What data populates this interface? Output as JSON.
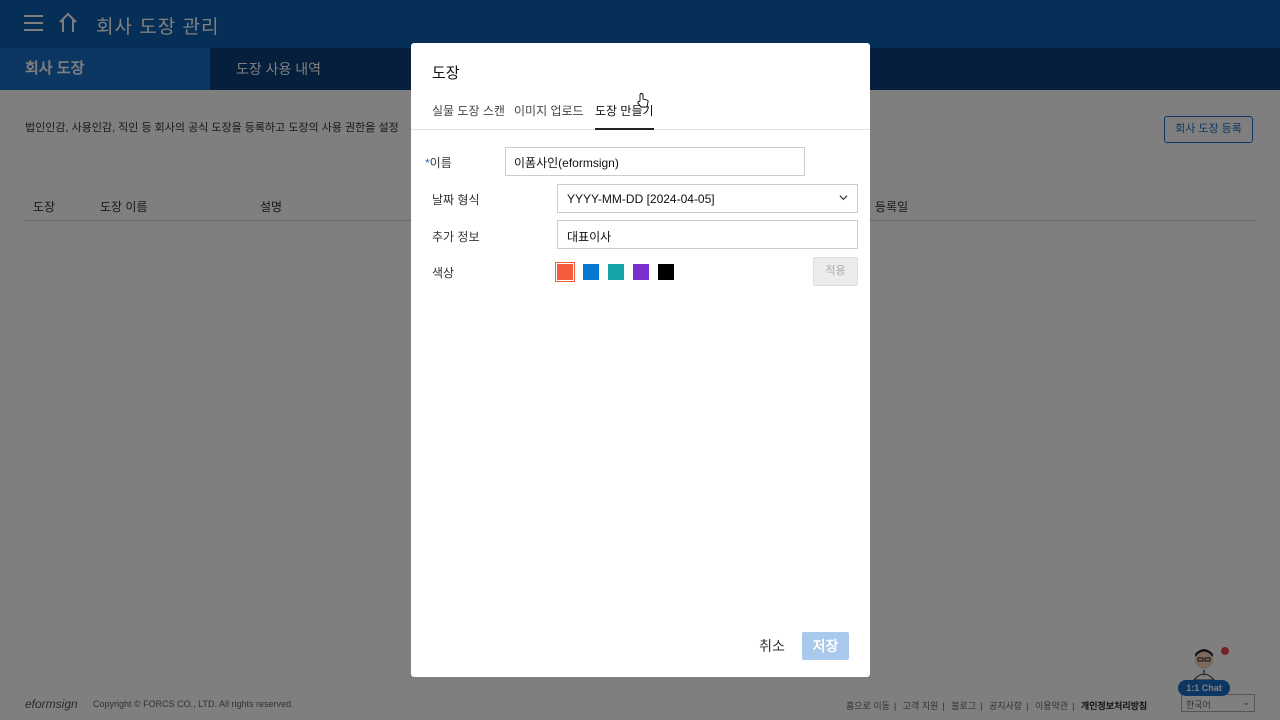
{
  "header": {
    "app_title": "회사 도장 관리"
  },
  "tabs": [
    {
      "label": "회사 도장"
    },
    {
      "label": "도장 사용 내역"
    }
  ],
  "description": "법인인감, 사용인감, 직인 등 회사의 공식 도장을 등록하고 도장의 사용 권한을 설정",
  "register_button": "회사 도장 등록",
  "table": {
    "headers": [
      "도장",
      "도장 이름",
      "설명",
      "등록일"
    ]
  },
  "footer": {
    "logo": "eformsign",
    "copyright": "Copyright © FORCS CO., LTD. All rights reserved.",
    "links": [
      "홈으로 이동",
      "고객 지원",
      "블로그",
      "공지사항",
      "이용약관",
      "개인정보처리방침"
    ],
    "language": "한국어"
  },
  "chat": {
    "label": "1:1 Chat"
  },
  "modal": {
    "title": "도장",
    "tabs": [
      "실물 도장 스캔",
      "이미지 업로드",
      "도장 만들기"
    ],
    "active_tab": "도장 만들기",
    "fields": {
      "name": {
        "label": "이름",
        "value": "이폼사인(eformsign)"
      },
      "date_format": {
        "label": "날짜 형식",
        "value": "YYYY-MM-DD [2024-04-05]"
      },
      "extra_info": {
        "label": "추가 정보",
        "value": "대표이사"
      },
      "color": {
        "label": "색상"
      }
    },
    "colors": [
      "#f25c3b",
      "#0a78d2",
      "#14a6a9",
      "#7b2fcf",
      "#000000"
    ],
    "apply_button": "적용",
    "cancel_button": "취소",
    "save_button": "저장"
  }
}
